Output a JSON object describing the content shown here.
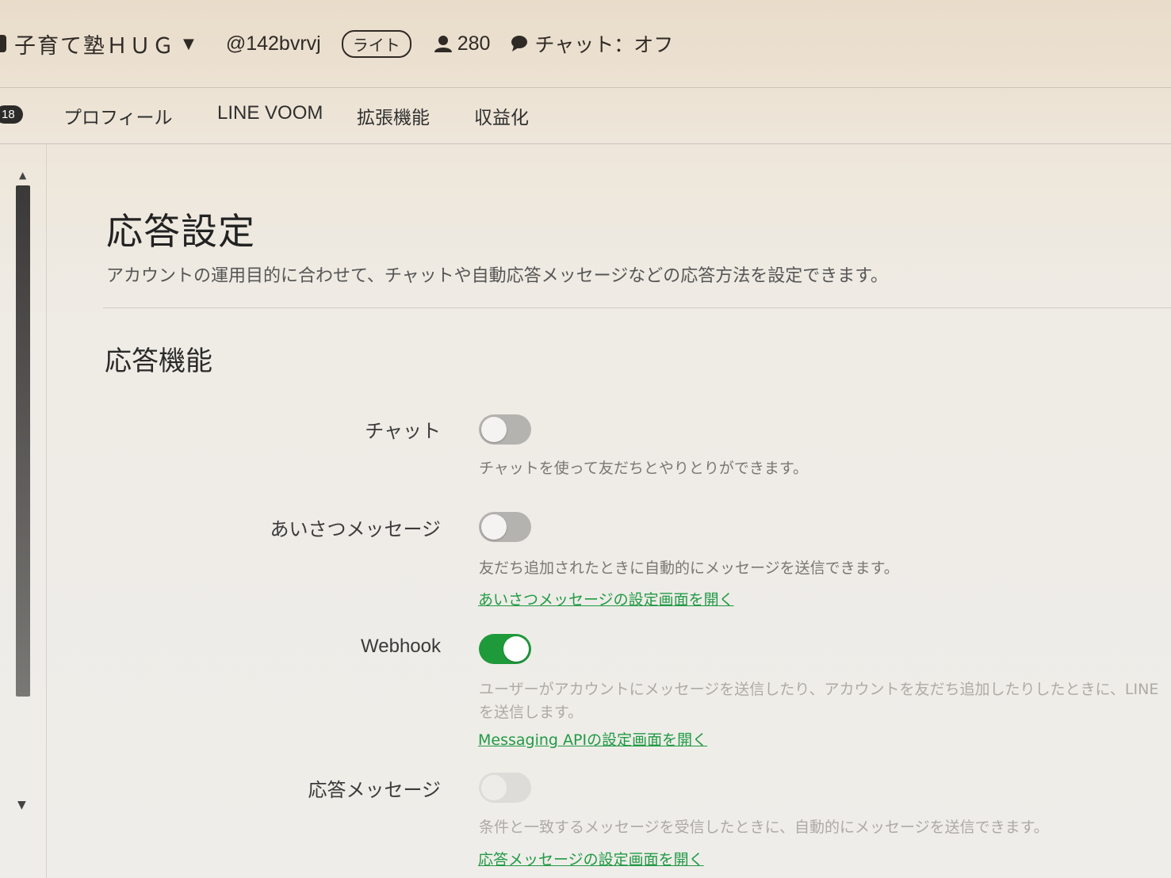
{
  "account": {
    "name": "子育て塾ＨＵＧ",
    "id": "@142bvrvj",
    "plan": "ライト",
    "friend_count": "280",
    "chat_status": "チャット：オフ"
  },
  "nav": {
    "badge_count": "18",
    "tabs": [
      {
        "label": "プロフィール"
      },
      {
        "label": "LINE VOOM"
      },
      {
        "label": "拡張機能"
      },
      {
        "label": "収益化"
      }
    ]
  },
  "page": {
    "title": "応答設定",
    "description": "アカウントの運用目的に合わせて、チャットや自動応答メッセージなどの応答方法を設定できます。",
    "section_title": "応答機能"
  },
  "settings": [
    {
      "label": "チャット",
      "state": "off",
      "description": "チャットを使って友だちとやりとりができます。",
      "link": ""
    },
    {
      "label": "あいさつメッセージ",
      "state": "off",
      "description": "友だち追加されたときに自動的にメッセージを送信できます。",
      "link": "あいさつメッセージの設定画面を開く"
    },
    {
      "label": "Webhook",
      "state": "on",
      "description_line1": "ユーザーがアカウントにメッセージを送信したり、アカウントを友だち追加したりしたときに、LINE",
      "description_line2": "を送信します。",
      "link": "Messaging APIの設定画面を開く"
    },
    {
      "label": "応答メッセージ",
      "state": "disabled",
      "description": "条件と一致するメッセージを受信したときに、自動的にメッセージを送信できます。",
      "link": "応答メッセージの設定画面を開く"
    }
  ],
  "colors": {
    "toggle_on": "#1f9a3b",
    "link": "#219a45"
  }
}
